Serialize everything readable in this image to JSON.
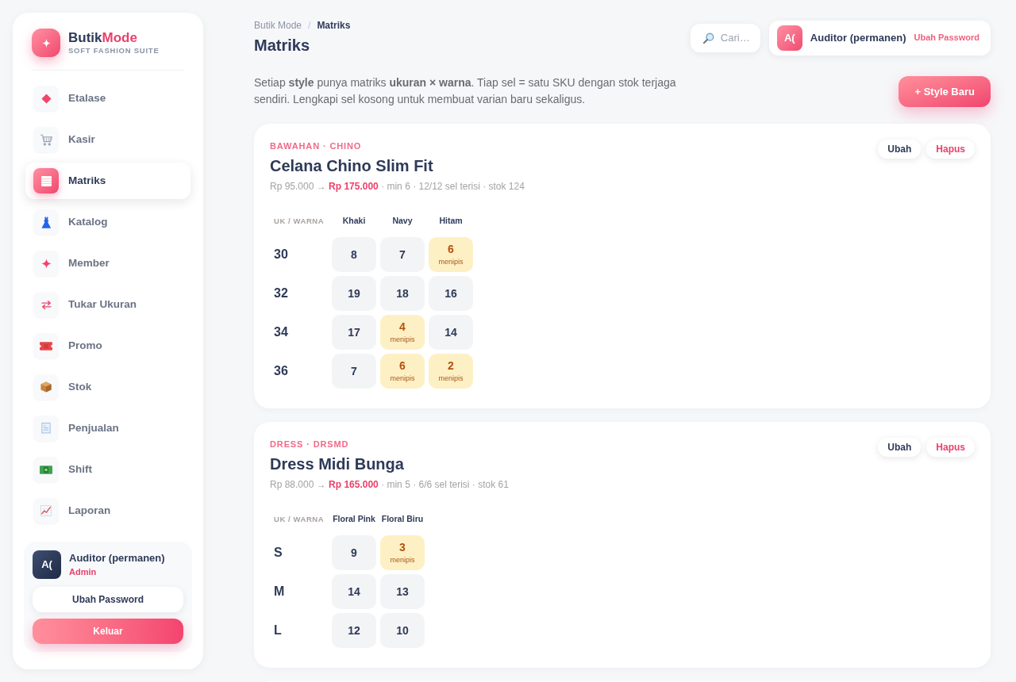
{
  "sidebar": {
    "brand": {
      "name": "Butik",
      "accent": "Mode",
      "tagline": "SOFT FASHION SUITE"
    },
    "items": [
      {
        "label": "Etalase",
        "kind": "diamond",
        "selected": false
      },
      {
        "label": "Kasir",
        "kind": "cart",
        "selected": false
      },
      {
        "label": "Matriks",
        "kind": "table",
        "selected": true
      },
      {
        "label": "Katalog",
        "kind": "dress",
        "selected": false
      },
      {
        "label": "Member",
        "kind": "sparkle",
        "selected": false
      },
      {
        "label": "Tukar Ukuran",
        "kind": "swap",
        "selected": false
      },
      {
        "label": "Promo",
        "kind": "ticket",
        "selected": false
      },
      {
        "label": "Stok",
        "kind": "box",
        "selected": false
      },
      {
        "label": "Penjualan",
        "kind": "receipt",
        "selected": false
      },
      {
        "label": "Shift",
        "kind": "cash",
        "selected": false
      },
      {
        "label": "Laporan",
        "kind": "chart",
        "selected": false
      }
    ],
    "user": {
      "initials": "A(",
      "name": "Auditor (permanen)",
      "role": "Admin"
    },
    "buttons": [
      {
        "label": "Ubah Password",
        "kind": "plain"
      },
      {
        "label": "Keluar",
        "kind": "accent"
      }
    ]
  },
  "header": {
    "breadcrumb": [
      {
        "label": "Butik Mode",
        "current": false
      },
      {
        "label": "Matriks",
        "current": true
      }
    ],
    "separator": "/",
    "title": "Matriks",
    "search": {
      "placeholder": "Cari…"
    },
    "user": {
      "initials": "A(",
      "name": "Auditor (permanen)",
      "link": "Ubah Password"
    }
  },
  "intro": "Setiap **style** punya matriks **ukuran × warna**. Tiap sel = satu SKU dengan stok terjaga sendiri. Lengkapi sel kosong untuk membuat varian baru sekaligus.",
  "new_button": "+ Style Baru",
  "styles": [
    {
      "category": "BAWAHAN · CHINO",
      "name": "Celana Chino Slim Fit",
      "cost": "Rp 95.000 →",
      "price": "Rp 175.000",
      "details": "· min 6 · 12/12 sel terisi · stok 124",
      "actions": [
        {
          "label": "Ubah",
          "kind": "edit"
        },
        {
          "label": "Hapus",
          "kind": "delete"
        }
      ],
      "corner": "UK / WARNA",
      "colors": [
        "Khaki",
        "Navy",
        "Hitam"
      ],
      "rows": [
        {
          "size": "30",
          "cells": [
            {
              "value": "8",
              "low": false
            },
            {
              "value": "7",
              "low": false
            },
            {
              "value": "6",
              "low": true,
              "note": "menipis"
            }
          ]
        },
        {
          "size": "32",
          "cells": [
            {
              "value": "19",
              "low": false
            },
            {
              "value": "18",
              "low": false
            },
            {
              "value": "16",
              "low": false
            }
          ]
        },
        {
          "size": "34",
          "cells": [
            {
              "value": "17",
              "low": false
            },
            {
              "value": "4",
              "low": true,
              "note": "menipis"
            },
            {
              "value": "14",
              "low": false
            }
          ]
        },
        {
          "size": "36",
          "cells": [
            {
              "value": "7",
              "low": false
            },
            {
              "value": "6",
              "low": true,
              "note": "menipis"
            },
            {
              "value": "2",
              "low": true,
              "note": "menipis"
            }
          ]
        }
      ]
    },
    {
      "category": "DRESS · DRSMD",
      "name": "Dress Midi Bunga",
      "cost": "Rp 88.000 →",
      "price": "Rp 165.000",
      "details": "· min 5 · 6/6 sel terisi · stok 61",
      "actions": [
        {
          "label": "Ubah",
          "kind": "edit"
        },
        {
          "label": "Hapus",
          "kind": "delete"
        }
      ],
      "corner": "UK / WARNA",
      "colors": [
        "Floral Pink",
        "Floral Biru"
      ],
      "rows": [
        {
          "size": "S",
          "cells": [
            {
              "value": "9",
              "low": false
            },
            {
              "value": "3",
              "low": true,
              "note": "menipis"
            }
          ]
        },
        {
          "size": "M",
          "cells": [
            {
              "value": "14",
              "low": false
            },
            {
              "value": "13",
              "low": false
            }
          ]
        },
        {
          "size": "L",
          "cells": [
            {
              "value": "12",
              "low": false
            },
            {
              "value": "10",
              "low": false
            }
          ]
        }
      ]
    }
  ]
}
